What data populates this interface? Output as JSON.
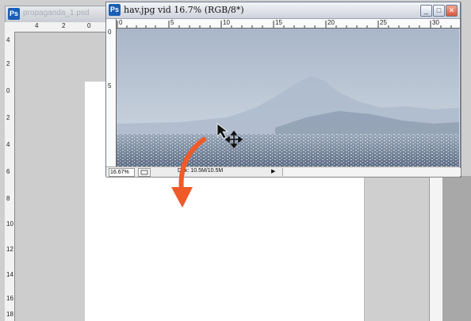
{
  "background_window": {
    "title": "propaganda_1.psd",
    "icon": "photoshop-icon",
    "ruler_top_labels": [
      "4",
      "2",
      "0"
    ],
    "ruler_left_labels": [
      "4",
      "2",
      "0",
      "2",
      "4",
      "6",
      "8",
      "10",
      "12",
      "14",
      "16",
      "18"
    ]
  },
  "image_window": {
    "title": "hav.jpg vid 16.7% (RGB/8*)",
    "icon": "photoshop-icon",
    "ruler_top_labels": [
      "0",
      "5",
      "10",
      "15",
      "20",
      "25",
      "30"
    ],
    "ruler_left_labels": [
      "0",
      "5"
    ],
    "buttons": {
      "minimize": "_",
      "maximize": "□",
      "close": "✕"
    }
  },
  "status_bar": {
    "zoom": "16.67%",
    "doc_info": "Dok: 10.5M/10.5M",
    "arrow": "▶"
  },
  "cursor": {
    "icon": "move-tool-cursor-icon"
  },
  "drag_hint": {
    "icon": "curved-arrow-icon",
    "color": "#f05a28"
  }
}
